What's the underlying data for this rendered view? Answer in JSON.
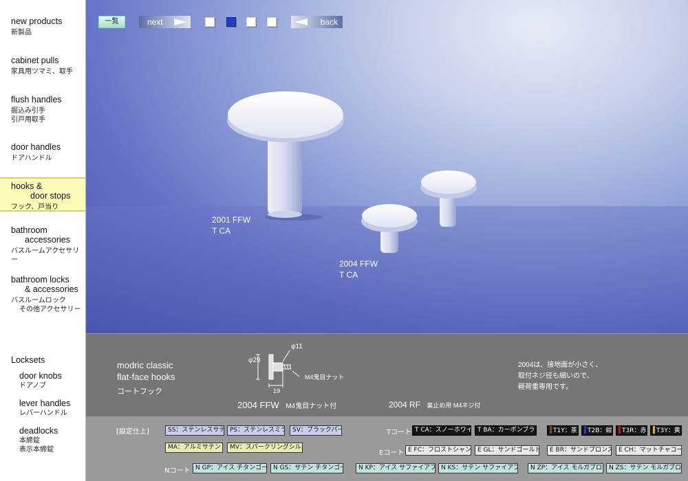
{
  "nav": {
    "items": [
      {
        "en": "new products",
        "jp": "新製品"
      },
      {
        "en": "cabinet pulls",
        "jp": "家具用ツマミ、取手"
      },
      {
        "en": "flush handles",
        "jp": "掘込み引手",
        "jp2": "引戸用取手"
      },
      {
        "en": "door handles",
        "jp": "ドアハンドル"
      },
      {
        "en": "hooks &",
        "en2": "door stops",
        "jp": "フック、戸当り"
      },
      {
        "en": "bathroom",
        "en2": "accessories",
        "jp": "バスルームアクセサリー"
      },
      {
        "en": "bathroom locks",
        "en2": "& accessories",
        "jp": "バスルームロック",
        "jp2": "その他アクセサリー"
      },
      {
        "en": "Locksets"
      },
      {
        "en": "door knobs",
        "jp": "ドアノブ"
      },
      {
        "en": "lever handles",
        "jp": "レバーハンドル"
      },
      {
        "en": "deadlocks",
        "jp": "本締錠",
        "jp2": "表示本締錠"
      }
    ]
  },
  "toolbar": {
    "list_label": "一覧",
    "next_label": "next",
    "back_label": "back",
    "current_page": 2,
    "page_count": 4
  },
  "photo": {
    "caption1": [
      "2001 FFW",
      "T CA"
    ],
    "caption2": [
      "2004 FFW",
      "T CA"
    ]
  },
  "info": {
    "title1": "modric classic",
    "title2": "flat-face hooks",
    "title_jp": "コートフック",
    "dim_diam_top": "φ11",
    "dim_diam_left": "φ29",
    "dim_width": "19",
    "dim_nut": "M4鬼目ナット",
    "model1": "2004 FFW",
    "model1_note": "M4鬼目ナット付",
    "model2": "2004 RF",
    "model2_note": "裏止め用 M4ネジ付",
    "desc": [
      "2004は、接地面が小さく、",
      "取付ネジ径も細いので、",
      "軽荷重専用です。"
    ]
  },
  "specs": {
    "label": "[設定仕上]",
    "t_label": "Tコート",
    "e_label": "Eコート",
    "n_label": "Nコート",
    "finishes": [
      "SS：ステンレスサテン",
      "PS：ステンレスミラー",
      "SV：ブラックパール",
      "MA：アルミサテン",
      "MV：スパークリングシルバー"
    ],
    "t_coats": [
      "T CA：スノーホワイト",
      "T BA：カーボンブラック",
      "T1Y：茶",
      "T2B：紺",
      "T3R：赤",
      "T3Y：黄"
    ],
    "e_coats": [
      "E FC：フロストシャンパン",
      "E GL：サンドゴールド",
      "E BR：サンドブロンズ",
      "E CH：マットチャコール"
    ],
    "n_coats": [
      "N GP：アイス チタンゴールド",
      "N GS：サテン チタンゴールド",
      "N KP：アイス サファイアブラック",
      "N KS：サテン サファイアブラック",
      "N ZP：アイス モルガブロンズ",
      "N ZS：サテン モルガブロンズ"
    ],
    "colors": {
      "t1y": "#7a4a1c",
      "t2b": "#1b2a8a",
      "t3r": "#c01818",
      "t3y": "#e0b800"
    }
  }
}
